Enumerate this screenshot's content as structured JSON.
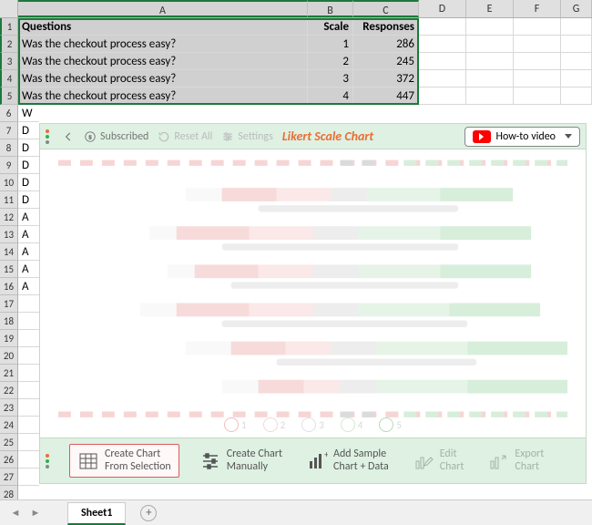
{
  "columns": [
    "A",
    "B",
    "C",
    "D",
    "E",
    "F",
    "G"
  ],
  "header_row": {
    "q": "Questions",
    "scale": "Scale",
    "resp": "Responses"
  },
  "data_rows": [
    {
      "q": "Was the checkout process easy?",
      "scale": "1",
      "resp": "286"
    },
    {
      "q": "Was the checkout process easy?",
      "scale": "2",
      "resp": "245"
    },
    {
      "q": "Was the checkout process easy?",
      "scale": "3",
      "resp": "372"
    },
    {
      "q": "Was the checkout process easy?",
      "scale": "4",
      "resp": "447"
    }
  ],
  "clipped": [
    {
      "n": "6",
      "t": "W"
    },
    {
      "n": "7",
      "t": "D"
    },
    {
      "n": "8",
      "t": "D"
    },
    {
      "n": "9",
      "t": "D"
    },
    {
      "n": "10",
      "t": "D"
    },
    {
      "n": "11",
      "t": "D"
    },
    {
      "n": "12",
      "t": "A"
    },
    {
      "n": "13",
      "t": "A"
    },
    {
      "n": "14",
      "t": "A"
    },
    {
      "n": "15",
      "t": "A"
    },
    {
      "n": "16",
      "t": "A"
    }
  ],
  "empty_rows": [
    "17",
    "18",
    "19",
    "20",
    "21",
    "22",
    "23",
    "24",
    "25",
    "26",
    "27",
    "28"
  ],
  "pane": {
    "subscribed": "Subscribed",
    "reset": "Reset All",
    "settings": "Settings",
    "title": "Likert Scale Chart",
    "howto": "How-to video",
    "legend": [
      "1",
      "2",
      "3",
      "4",
      "5"
    ]
  },
  "footer": {
    "create_sel": "Create Chart\nFrom Selection",
    "create_man": "Create Chart\nManually",
    "add_sample": "Add Sample\nChart + Data",
    "edit": "Edit\nChart",
    "export": "Export\nChart"
  },
  "tabs": {
    "sheet1": "Sheet1"
  }
}
